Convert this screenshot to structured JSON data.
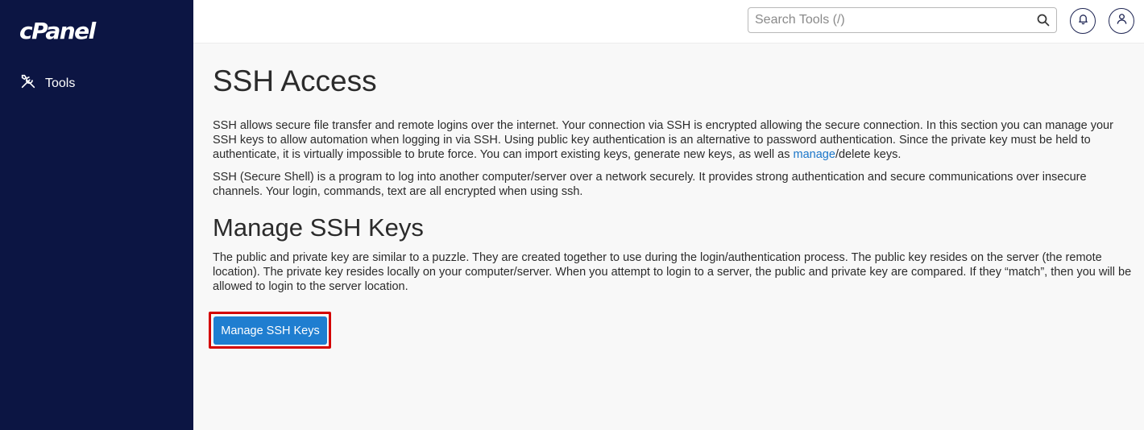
{
  "app": {
    "logo_text": "cPanel"
  },
  "sidebar": {
    "items": [
      {
        "label": "Tools",
        "icon": "tools-icon"
      }
    ]
  },
  "header": {
    "search": {
      "placeholder": "Search Tools (/)",
      "value": ""
    },
    "icons": [
      "search-icon",
      "bell-icon",
      "user-icon"
    ]
  },
  "main": {
    "title": "SSH Access",
    "intro_before_link": "SSH allows secure file transfer and remote logins over the internet. Your connection via SSH is encrypted allowing the secure connection. In this section you can manage your SSH keys to allow automation when logging in via SSH. Using public key authentication is an alternative to password authentication. Since the private key must be held to authenticate, it is virtually impossible to brute force. You can import existing keys, generate new keys, as well as ",
    "intro_link": "manage",
    "intro_after_link": "/delete keys.",
    "secure_shell_text": "SSH (Secure Shell) is a program to log into another computer/server over a network securely. It provides strong authentication and secure communications over insecure channels. Your login, commands, text are all encrypted when using ssh.",
    "section_title": "Manage SSH Keys",
    "section_text": "The public and private key are similar to a puzzle. They are created together to use during the login/authentication process. The public key resides on the server (the remote location). The private key resides locally on your computer/server. When you attempt to login to a server, the public and private key are compared. If they “match”, then you will be allowed to login to the server location.",
    "button_label": "Manage SSH Keys"
  },
  "colors": {
    "sidebar_bg": "#0c1543",
    "primary_button": "#1f7ed0",
    "link": "#1a76c9",
    "highlight_border": "#d40000"
  }
}
